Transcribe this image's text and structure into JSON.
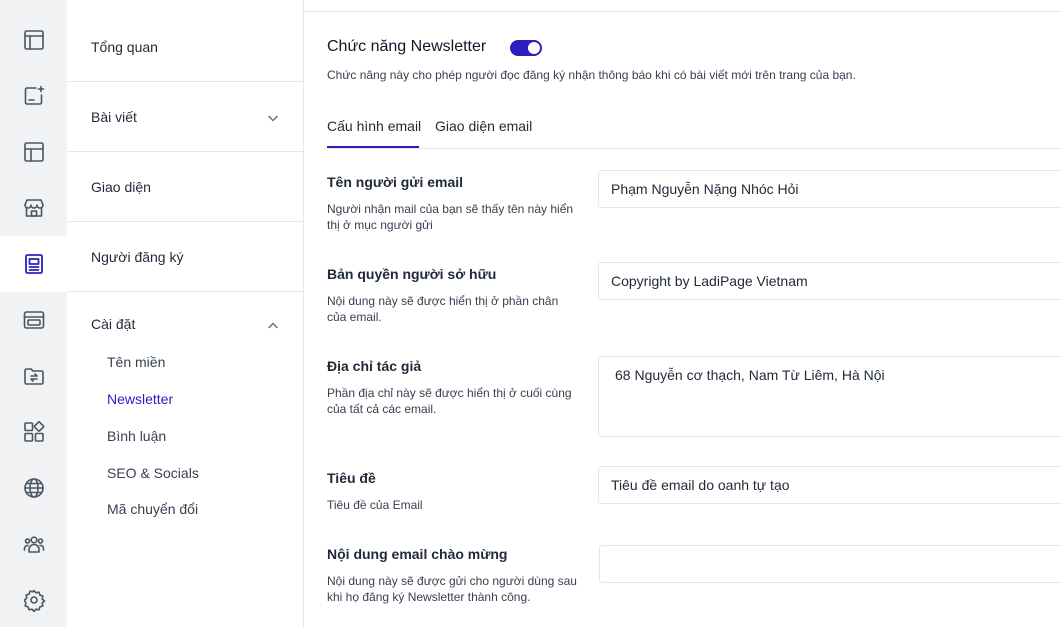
{
  "rail": {
    "items": [
      {
        "icon": "dashboard-icon",
        "active": false
      },
      {
        "icon": "new-post-icon",
        "active": false
      },
      {
        "icon": "layout-icon",
        "active": false
      },
      {
        "icon": "store-icon",
        "active": false
      },
      {
        "icon": "blog-icon",
        "active": true
      },
      {
        "icon": "browser-icon",
        "active": false
      },
      {
        "icon": "folder-sync-icon",
        "active": false
      },
      {
        "icon": "apps-icon",
        "active": false
      },
      {
        "icon": "globe-icon",
        "active": false
      },
      {
        "icon": "users-icon",
        "active": false
      },
      {
        "icon": "settings-icon",
        "active": false
      }
    ]
  },
  "subnav": {
    "overview": "Tổng quan",
    "posts": "Bài viết",
    "appearance": "Giao diện",
    "subscribers": "Người đăng ký",
    "settings": {
      "title": "Cài đặt",
      "items": [
        "Tên miền",
        "Newsletter",
        "Bình luận",
        "SEO & Socials",
        "Mã chuyển đổi"
      ],
      "active_index": 1
    }
  },
  "main": {
    "title": "Chức năng Newsletter",
    "toggle_on": true,
    "description": "Chức năng này cho phép người đọc đăng ký nhận thông báo khi có bài viết mới trên trang của bạn.",
    "tabs": [
      "Cấu hình email",
      "Giao diện email"
    ],
    "active_tab": 0,
    "fields": [
      {
        "label": "Tên người gửi email",
        "help": "Người nhận mail của bạn sẽ thấy tên này hiển thị ở mục người gửi",
        "value": "Phạm Nguyễn Nặng Nhóc Hỏi"
      },
      {
        "label": "Bản quyền người sở hữu",
        "help": "Nội dung này sẽ được hiển thị ở phần chân của email.",
        "value": "Copyright by LadiPage Vietnam"
      },
      {
        "label": "Địa chỉ tác giả",
        "help": "Phần địa chỉ này sẽ được hiển thị ở cuối cùng của tất cả các email.",
        "value": "68 Nguyễn cơ thạch, Nam Từ Liêm, Hà Nội"
      },
      {
        "label": "Tiêu đề",
        "help": "Tiêu đề của Email",
        "value": "Tiêu đề email do oanh tự tạo"
      },
      {
        "label": "Nội dung email chào mừng",
        "help": "Nội dung này sẽ được gửi cho người dùng sau khi họ đăng ký Newsletter thành công.",
        "value": ""
      }
    ]
  },
  "colors": {
    "accent": "#2a1fbf",
    "rail_bg": "#f1f2f4",
    "border": "#e5e7eb"
  }
}
